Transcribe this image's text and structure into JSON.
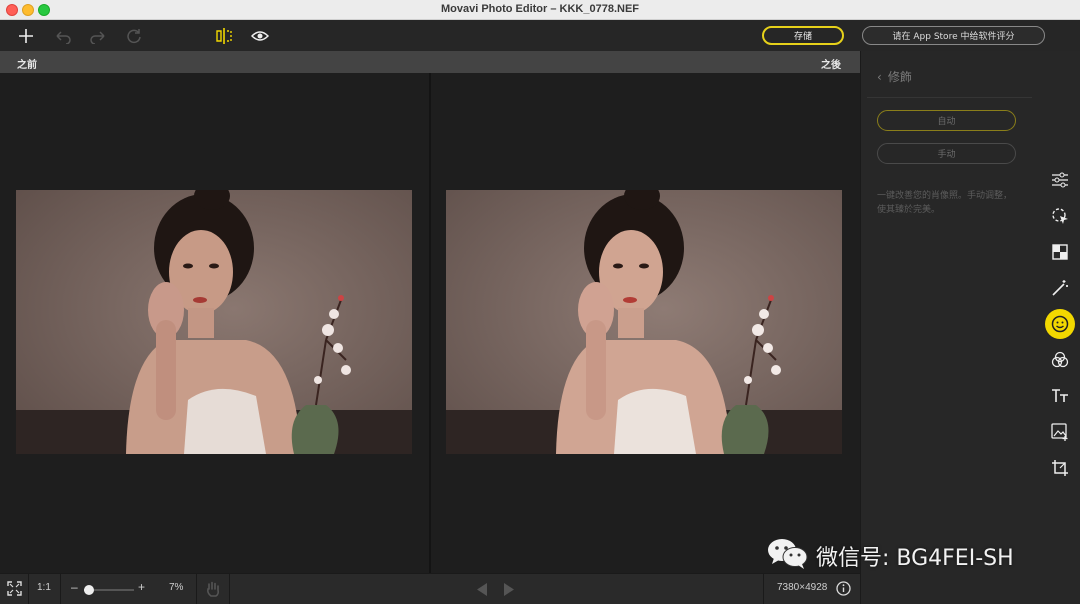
{
  "window": {
    "title": "Movavi Photo Editor – KKK_0778.NEF"
  },
  "toolbar": {
    "add_icon": "plus-icon",
    "undo_icon": "undo-icon",
    "redo_icon": "redo-icon",
    "reset_icon": "reset-icon",
    "compare_icon": "split-view-icon",
    "preview_icon": "eye-icon",
    "save_label": "存储",
    "rate_label": "请在 App Store 中给软件评分"
  },
  "compare": {
    "before_label": "之前",
    "after_label": "之後"
  },
  "panel": {
    "title": "修飾",
    "auto_label": "自动",
    "manual_label": "手动",
    "description": "一键改善您的肖像照。手动调整，使其臻於完美。"
  },
  "rail": {
    "tools": [
      {
        "name": "adjust-icon",
        "active": false
      },
      {
        "name": "select-icon",
        "active": false
      },
      {
        "name": "background-icon",
        "active": false
      },
      {
        "name": "magic-wand-icon",
        "active": false
      },
      {
        "name": "retouch-face-icon",
        "active": true
      },
      {
        "name": "filters-icon",
        "active": false
      },
      {
        "name": "text-icon",
        "active": false
      },
      {
        "name": "insert-image-icon",
        "active": false
      },
      {
        "name": "crop-icon",
        "active": false
      }
    ],
    "accent_color": "#f2d800"
  },
  "bottom": {
    "fit_icon": "fit-screen-icon",
    "ratio_label": "1:1",
    "zoom_minus": "–",
    "zoom_plus": "+",
    "zoom_value": "7%",
    "zoom_fraction": 0.1,
    "hand_icon": "hand-icon",
    "prev_icon": "prev-arrow-icon",
    "next_icon": "next-arrow-icon",
    "dimensions": "7380×4928",
    "info_icon": "info-icon"
  },
  "watermark": {
    "text": "微信号: BG4FEI-SH"
  }
}
